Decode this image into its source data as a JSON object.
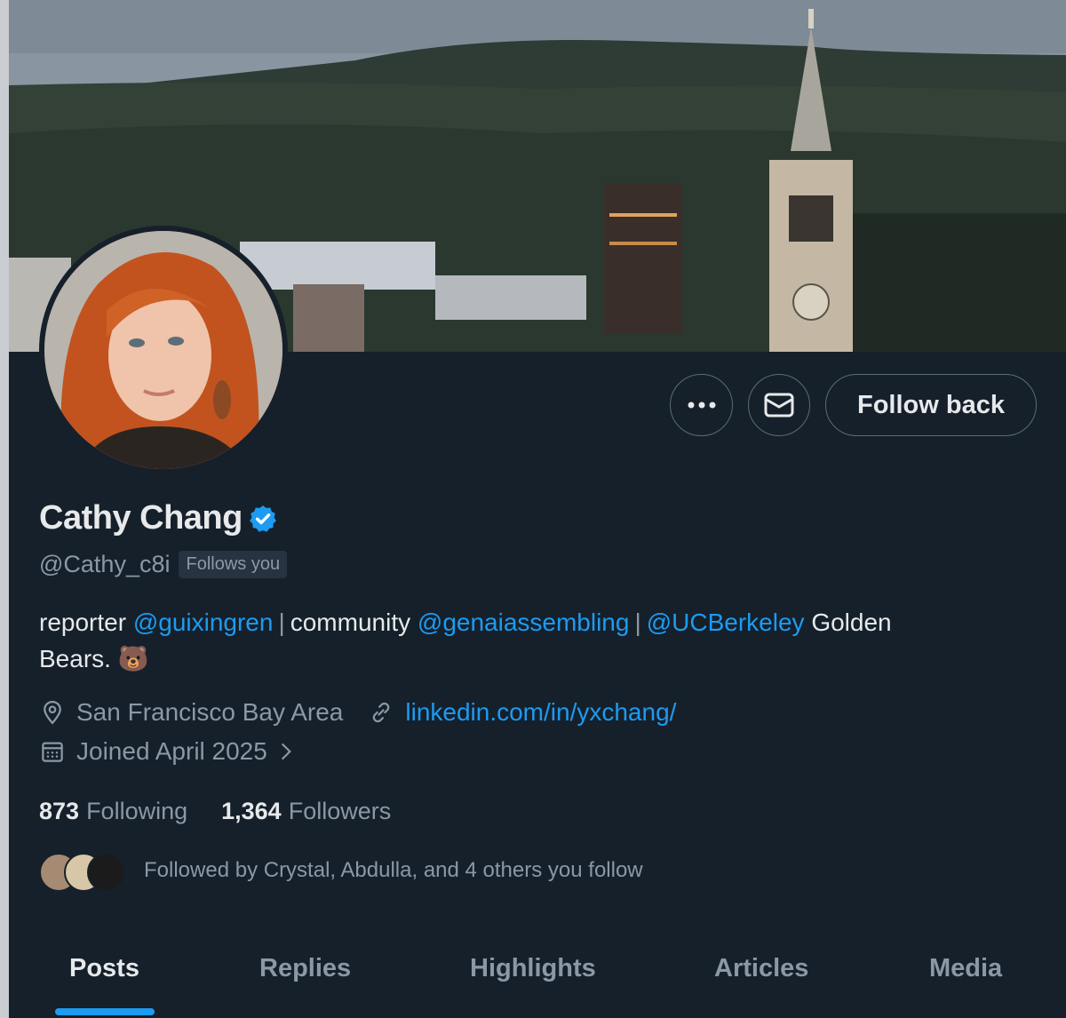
{
  "profile": {
    "display_name": "Cathy Chang",
    "handle": "@Cathy_c8i",
    "follows_you_badge": "Follows you",
    "bio": {
      "prefix": "reporter",
      "mention1": "@guixingren",
      "sep1": "|",
      "middle": "community",
      "mention2": "@genaiassembling",
      "sep2": "|",
      "mention3": "@UCBerkeley",
      "suffix": "Golden",
      "line2": "Bears. 🐻"
    },
    "location": "San Francisco Bay Area",
    "website": "linkedin.com/in/yxchang/",
    "joined": "Joined April 2025"
  },
  "actions": {
    "more_label": "More",
    "message_label": "Message",
    "follow_back_label": "Follow back"
  },
  "stats": {
    "following_count": "873",
    "following_label": "Following",
    "followers_count": "1,364",
    "followers_label": "Followers"
  },
  "followed_by": "Followed by Crystal, Abdulla, and 4 others you follow",
  "tabs": [
    {
      "label": "Posts",
      "active": true
    },
    {
      "label": "Replies",
      "active": false
    },
    {
      "label": "Highlights",
      "active": false
    },
    {
      "label": "Articles",
      "active": false
    },
    {
      "label": "Media",
      "active": false
    }
  ],
  "colors": {
    "background": "#15202b",
    "accent": "#1d9bf0",
    "text_primary": "#e7e9ea",
    "text_secondary": "#8b98a5"
  },
  "icons": {
    "verified": "verified-badge-icon",
    "location": "location-pin-icon",
    "link": "link-icon",
    "calendar": "calendar-icon",
    "chevron": "chevron-right-icon",
    "more": "more-dots-icon",
    "message": "envelope-icon"
  }
}
